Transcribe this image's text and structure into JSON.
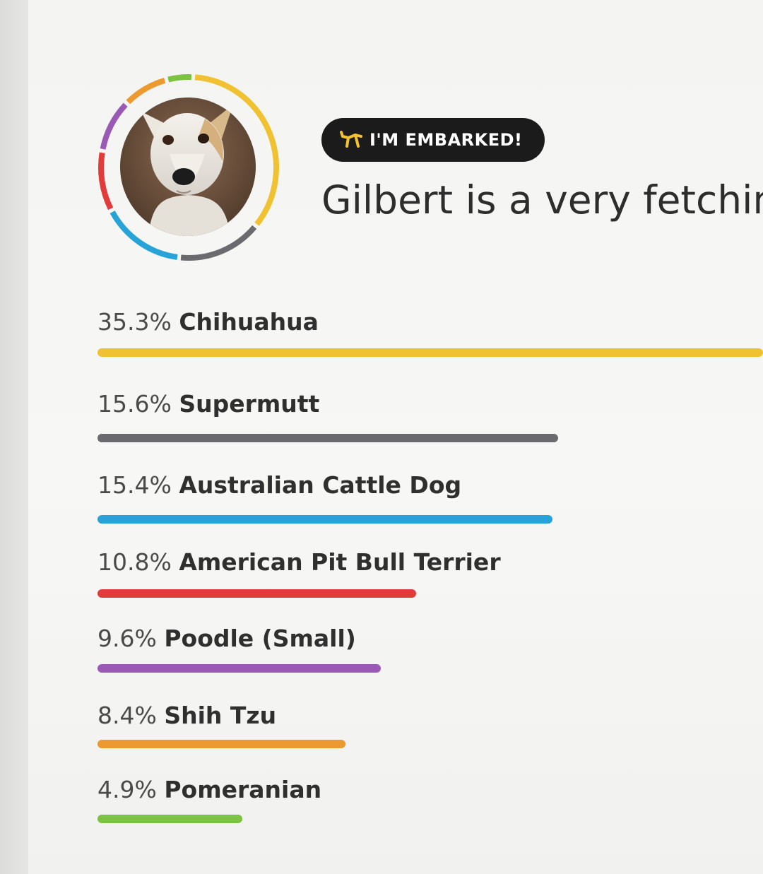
{
  "badge": {
    "icon": "balloon-dog-icon",
    "label": "I'M EMBARKED!",
    "icon_color": "#f2c230"
  },
  "headline": "Gilbert is a very fetching",
  "avatar": {
    "subject": "dog-photo",
    "ring_colors": [
      "#f0c232",
      "#6b6b6f",
      "#27a3d8",
      "#e23b3b",
      "#9b59b6",
      "#ec9a2f",
      "#7dc242"
    ]
  },
  "breeds": [
    {
      "pct": "35.3%",
      "name": "Chihuahua",
      "value": 35.3,
      "color": "#f0c232"
    },
    {
      "pct": "15.6%",
      "name": "Supermutt",
      "value": 15.6,
      "color": "#6b6b6f"
    },
    {
      "pct": "15.4%",
      "name": "Australian Cattle Dog",
      "value": 15.4,
      "color": "#27a3d8"
    },
    {
      "pct": "10.8%",
      "name": "American Pit Bull Terrier",
      "value": 10.8,
      "color": "#e23b3b"
    },
    {
      "pct": "9.6%",
      "name": "Poodle (Small)",
      "value": 9.6,
      "color": "#9b59b6"
    },
    {
      "pct": "8.4%",
      "name": "Shih Tzu",
      "value": 8.4,
      "color": "#ec9a2f"
    },
    {
      "pct": "4.9%",
      "name": "Pomeranian",
      "value": 4.9,
      "color": "#7dc242"
    }
  ]
}
